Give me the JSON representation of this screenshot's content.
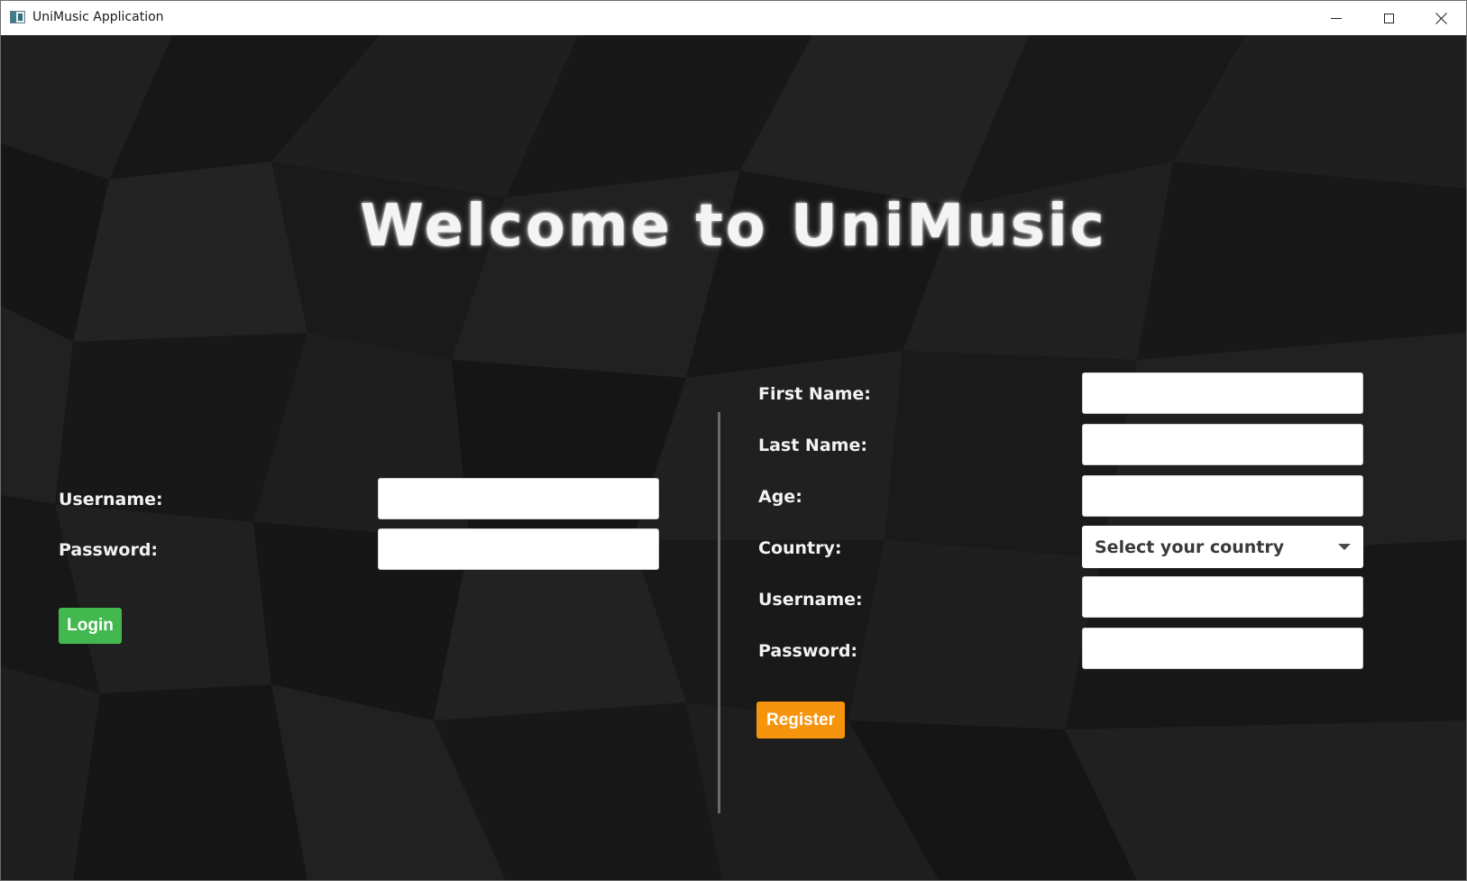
{
  "window": {
    "title": "UniMusic Application"
  },
  "welcome": {
    "title": "Welcome to UniMusic"
  },
  "login": {
    "username_label": "Username:",
    "username_value": "",
    "password_label": "Password:",
    "password_value": "",
    "button_label": "Login"
  },
  "register": {
    "first_name_label": "First Name:",
    "last_name_label": "Last Name:",
    "age_label": "Age:",
    "country_label": "Country:",
    "country_placeholder": "Select your country",
    "username_label": "Username:",
    "password_label": "Password:",
    "button_label": "Register"
  },
  "colors": {
    "background": "#1b1b1b",
    "login_button": "#43b84e",
    "register_button": "#f7940e",
    "label_text": "#f2f2f2"
  },
  "icons": {
    "app": "app-window-icon",
    "minimize": "minimize-icon",
    "maximize": "maximize-icon",
    "close": "close-icon",
    "dropdown": "chevron-down-icon"
  }
}
